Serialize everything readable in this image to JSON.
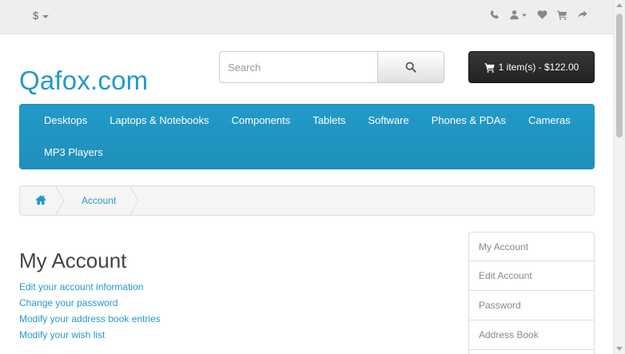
{
  "topbar": {
    "currency_symbol": "$",
    "icons": [
      "phone-icon",
      "user-icon",
      "heart-icon",
      "cart-icon",
      "share-icon"
    ]
  },
  "header": {
    "logo": "Qafox.com",
    "search": {
      "placeholder": "Search",
      "value": ""
    },
    "cart_label": "1 item(s) - $122.00"
  },
  "menu": {
    "items": [
      "Desktops",
      "Laptops & Notebooks",
      "Components",
      "Tablets",
      "Software",
      "Phones & PDAs",
      "Cameras",
      "MP3 Players"
    ]
  },
  "breadcrumb": {
    "home_icon": "home-icon",
    "current": "Account"
  },
  "main": {
    "title": "My Account",
    "links": [
      "Edit your account information",
      "Change your password",
      "Modify your address book entries",
      "Modify your wish list"
    ]
  },
  "sidebar": {
    "items": [
      "My Account",
      "Edit Account",
      "Password",
      "Address Book"
    ]
  },
  "colors": {
    "brand": "#229ac8",
    "cart_bg": "#222222",
    "topbar_bg": "#eeeeee"
  }
}
